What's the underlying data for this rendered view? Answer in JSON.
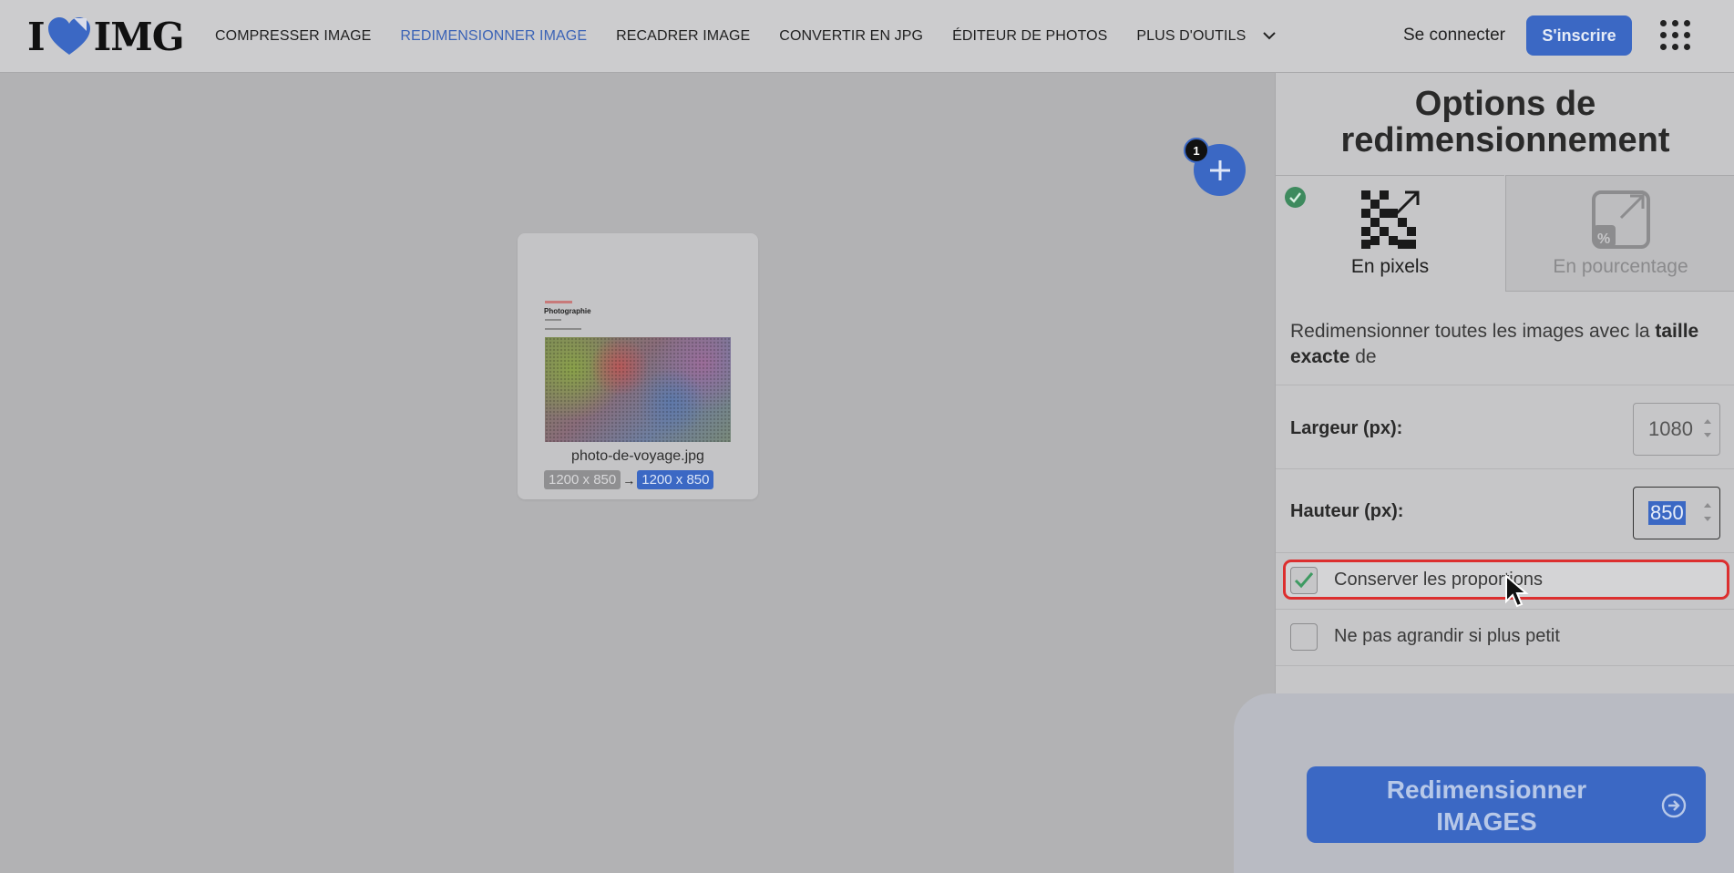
{
  "header": {
    "logo_text_left": "I",
    "logo_text_right": "IMG",
    "nav": [
      {
        "label": "COMPRESSER IMAGE",
        "active": false
      },
      {
        "label": "REDIMENSIONNER IMAGE",
        "active": true
      },
      {
        "label": "RECADRER IMAGE",
        "active": false
      },
      {
        "label": "CONVERTIR EN JPG",
        "active": false
      },
      {
        "label": "ÉDITEUR DE PHOTOS",
        "active": false
      },
      {
        "label": "PLUS D'OUTILS",
        "active": false
      }
    ],
    "login_label": "Se connecter",
    "signup_label": "S'inscrire",
    "accent_color": "#3b68c4"
  },
  "workspace": {
    "file": {
      "name": "photo-de-voyage.jpg",
      "thumb_title": "Photographie",
      "size_original": "1200 x 850",
      "size_arrow": "→",
      "size_new": "1200 x 850"
    },
    "add_button_icon": "plus-icon",
    "file_count": "1"
  },
  "panel": {
    "title_line1": "Options de",
    "title_line2": "redimensionnement",
    "tabs": [
      {
        "label": "En pixels",
        "icon": "pixel-grid-resize-icon",
        "selected": true
      },
      {
        "label": "En pourcentage",
        "icon": "percent-resize-icon",
        "selected": false
      }
    ],
    "description_pre": "Redimensionner toutes les images avec la ",
    "description_bold": "taille exacte",
    "description_post": " de",
    "width_label": "Largeur (px):",
    "width_value": "1080",
    "height_label": "Hauteur (px):",
    "height_value": "850",
    "keep_ratio_label": "Conserver les proportions",
    "keep_ratio_checked": true,
    "no_enlarge_label": "Ne pas agrandir si plus petit",
    "no_enlarge_checked": false
  },
  "cta": {
    "line1": "Redimensionner",
    "line2": "IMAGES"
  }
}
